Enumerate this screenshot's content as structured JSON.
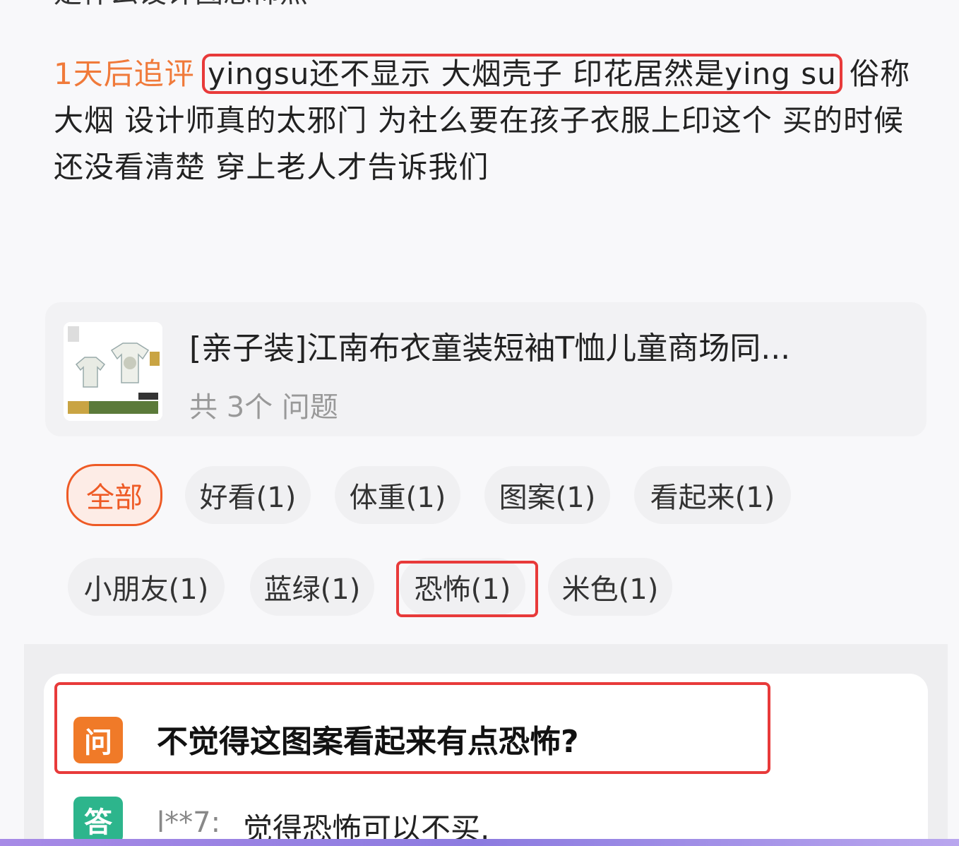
{
  "review": {
    "cut_line": "是什么设计图恐怖点",
    "followup_label": "1天后追评",
    "highlighted": "yingsu还不显示 大烟壳子 印花居然是ying su",
    "rest": "俗称大烟 设计师真的太邪门 为社么要在孩子衣服上印这个 买的时候还没看清楚 穿上老人才告诉我们"
  },
  "product": {
    "title": "[亲子装]江南布衣童装短袖T恤儿童商场同...",
    "question_count": "共 3个 问题"
  },
  "filters": [
    {
      "label": "全部",
      "active": true
    },
    {
      "label": "好看(1)"
    },
    {
      "label": "体重(1)"
    },
    {
      "label": "图案(1)"
    },
    {
      "label": "看起来(1)"
    },
    {
      "label": "小朋友(1)"
    },
    {
      "label": "蓝绿(1)"
    },
    {
      "label": "恐怖(1)",
      "highlighted": true
    },
    {
      "label": "米色(1)"
    }
  ],
  "qa": {
    "q_badge": "问",
    "question": "不觉得这图案看起来有点恐怖?",
    "a_badge": "答",
    "answer_user": "l**7:",
    "answer": "觉得恐怖可以不买."
  },
  "colors": {
    "accent": "#ee5a25",
    "highlight_box": "#e83a3a",
    "answer_badge": "#2db58c"
  }
}
